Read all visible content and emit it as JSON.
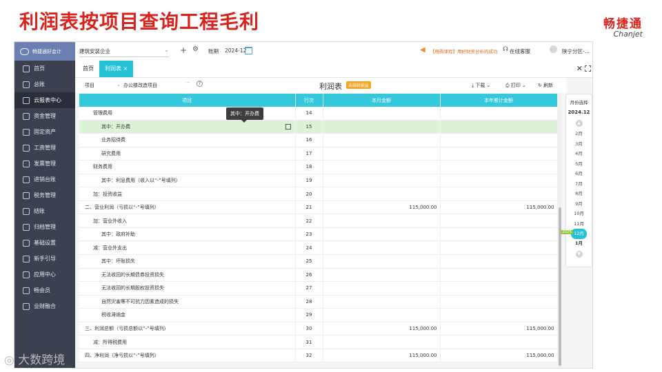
{
  "slide": {
    "title": "利润表按项目查询工程毛利",
    "brand_cn": "畅捷通",
    "brand_en": "Chanjet",
    "watermark": "大数跨境",
    "accent_color": "#d9231d"
  },
  "sidebar": {
    "app_name": "畅捷通好会计",
    "items": [
      {
        "label": "首页",
        "icon": "home-icon"
      },
      {
        "label": "总账",
        "icon": "ledger-icon"
      },
      {
        "label": "云报表中心",
        "icon": "chart-icon",
        "active": true
      },
      {
        "label": "资金管理",
        "icon": "wallet-icon"
      },
      {
        "label": "固定资产",
        "icon": "asset-icon"
      },
      {
        "label": "工资管理",
        "icon": "payroll-icon"
      },
      {
        "label": "发票管理",
        "icon": "invoice-icon"
      },
      {
        "label": "进销台账",
        "icon": "stock-icon"
      },
      {
        "label": "税务管理",
        "icon": "tax-icon"
      },
      {
        "label": "结账",
        "icon": "close-book-icon"
      },
      {
        "label": "归档管理",
        "icon": "archive-icon"
      },
      {
        "label": "基础设置",
        "icon": "settings-icon"
      },
      {
        "label": "新手引导",
        "icon": "guide-icon"
      },
      {
        "label": "应用中心",
        "icon": "apps-icon"
      },
      {
        "label": "畅会员",
        "icon": "vip-icon"
      },
      {
        "label": "业财融合",
        "icon": "fusion-icon"
      }
    ]
  },
  "topbar": {
    "company": "建筑安装企业",
    "period_label": "账期",
    "period_value": "2024-12",
    "promo_text": "【畅购课程】用好财务分析的成功",
    "support": "在线客服",
    "user": "陕宁分区-..."
  },
  "tabs": {
    "home": "首页",
    "active": "利润表",
    "close_symbol": "×"
  },
  "toolbar": {
    "project_label": "项目",
    "project_value": "办公楼改造项目",
    "report_title": "利润表",
    "status_badge": "未结转损益",
    "download": "下载",
    "print": "打印",
    "refresh": "刷新"
  },
  "table": {
    "headers": {
      "item": "项目",
      "line": "行次",
      "current": "本月金额",
      "ytd": "本年累计金额"
    },
    "tooltip": "其中：开办费",
    "rows": [
      {
        "item": "管理费用",
        "line": "14",
        "current": "",
        "ytd": "",
        "indent": 1
      },
      {
        "item": "其中：开办费",
        "line": "15",
        "current": "",
        "ytd": "",
        "indent": 2,
        "highlight": true
      },
      {
        "item": "业务招待费",
        "line": "16",
        "current": "",
        "ytd": "",
        "indent": 2
      },
      {
        "item": "研究费用",
        "line": "17",
        "current": "",
        "ytd": "",
        "indent": 2
      },
      {
        "item": "财务费用",
        "line": "18",
        "current": "",
        "ytd": "",
        "indent": 1
      },
      {
        "item": "其中：利息费用（收入以“-”号填列）",
        "line": "19",
        "current": "",
        "ytd": "",
        "indent": 2
      },
      {
        "item": "加：投资收益",
        "line": "20",
        "current": "",
        "ytd": "",
        "indent": 1
      },
      {
        "item": "二、营业利润（亏损以“-”号填列）",
        "line": "21",
        "current": "115,000.00",
        "ytd": "115,000.00",
        "indent": 0
      },
      {
        "item": "加：营业外收入",
        "line": "22",
        "current": "",
        "ytd": "",
        "indent": 1
      },
      {
        "item": "其中：政府补助",
        "line": "23",
        "current": "",
        "ytd": "",
        "indent": 2
      },
      {
        "item": "减：营业外支出",
        "line": "24",
        "current": "",
        "ytd": "",
        "indent": 1
      },
      {
        "item": "其中：坏账损失",
        "line": "25",
        "current": "",
        "ytd": "",
        "indent": 2
      },
      {
        "item": "无法收回的长期债券投资损失",
        "line": "26",
        "current": "",
        "ytd": "",
        "indent": 2
      },
      {
        "item": "无法收回的长期股权投资损失",
        "line": "27",
        "current": "",
        "ytd": "",
        "indent": 2
      },
      {
        "item": "自然灾害等不可抗力因素造成的损失",
        "line": "28",
        "current": "",
        "ytd": "",
        "indent": 2
      },
      {
        "item": "税收滞纳金",
        "line": "29",
        "current": "",
        "ytd": "",
        "indent": 2
      },
      {
        "item": "三、利润总额（亏损总额以“-”号填列）",
        "line": "30",
        "current": "115,000.00",
        "ytd": "115,000.00",
        "indent": 0
      },
      {
        "item": "减：所得税费用",
        "line": "31",
        "current": "",
        "ytd": "",
        "indent": 1
      },
      {
        "item": "四、净利润（净亏损以“-”号填列）",
        "line": "32",
        "current": "115,000.00",
        "ytd": "115,000.00",
        "indent": 0
      }
    ]
  },
  "month_picker": {
    "label": "月份选择",
    "year": "2024.12",
    "months": [
      "2月",
      "3月",
      "4月",
      "5月",
      "6月",
      "7月",
      "8月",
      "9月",
      "10月",
      "11月",
      "12月"
    ],
    "selected": "12月",
    "next_year_tag": "2025",
    "next_month": "1月"
  }
}
